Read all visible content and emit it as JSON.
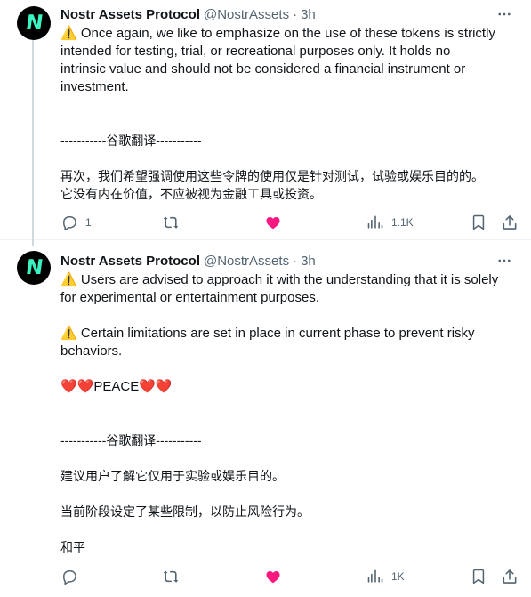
{
  "tweets": [
    {
      "author": {
        "name": "Nostr Assets Protocol",
        "handle": "@NostrAssets",
        "time": "3h",
        "avatar_text": "N"
      },
      "lines": [
        "⚠️ Once again, we like to emphasize on the use of these tokens is strictly",
        "intended for testing, trial, or recreational purposes only. It holds no",
        "intrinsic value and should not be considered a financial instrument or",
        "investment.",
        "",
        "",
        "-----------谷歌翻译-----------",
        "",
        "再次，我们希望强调使用这些令牌的使用仅是针对测试，试验或娱乐目的的。",
        "它没有内在价值，不应被视为金融工具或投资。"
      ],
      "actions": {
        "replies": "1",
        "reposts": "",
        "likes": "",
        "views": "1.1K"
      }
    },
    {
      "author": {
        "name": "Nostr Assets Protocol",
        "handle": "@NostrAssets",
        "time": "3h",
        "avatar_text": "N"
      },
      "lines": [
        "⚠️ Users are advised to approach it with the understanding that it is solely",
        "for experimental or entertainment purposes.",
        "",
        "⚠️ Certain limitations are set in place in current phase to prevent risky",
        "behaviors.",
        "",
        "❤️❤️PEACE❤️❤️",
        "",
        "",
        "-----------谷歌翻译-----------",
        "",
        "建议用户了解它仅用于实验或娱乐目的。",
        "",
        "当前阶段设定了某些限制，以防止风险行为。",
        "",
        "和平"
      ],
      "actions": {
        "replies": "",
        "reposts": "",
        "likes": "",
        "views": "1K"
      }
    }
  ],
  "icons": {
    "more": "more-icon",
    "reply": "reply-icon",
    "repost": "repost-icon",
    "like": "heart-filled-icon",
    "views": "views-chart-icon",
    "bookmark": "bookmark-icon",
    "share": "share-icon"
  },
  "colors": {
    "like": "#f91880",
    "secondary": "#536471",
    "text": "#0f1419",
    "avatar_bg": "#000000",
    "avatar_fg": "#39f5c2"
  }
}
